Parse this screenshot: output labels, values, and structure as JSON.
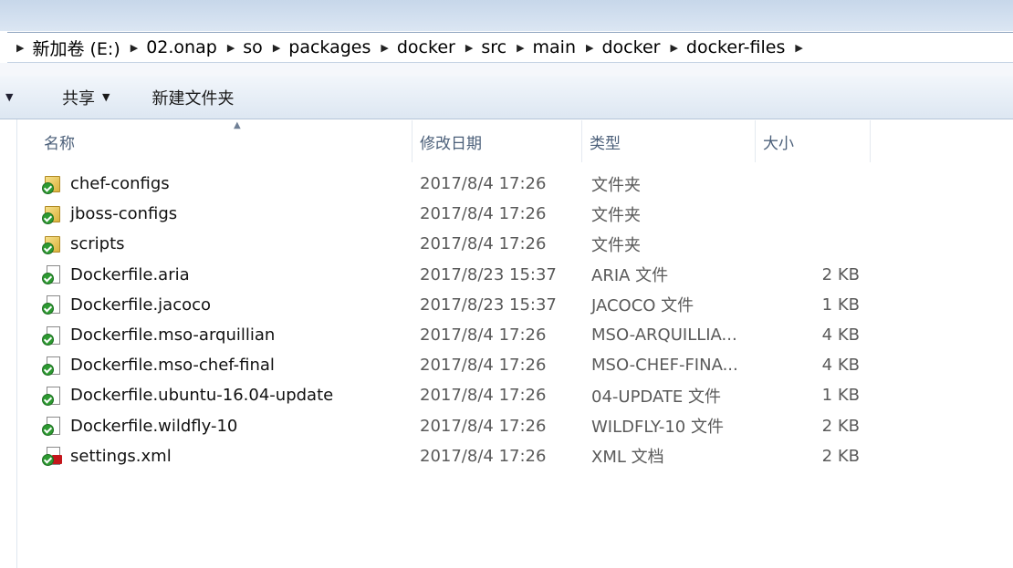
{
  "breadcrumb": [
    "新加卷 (E:)",
    "02.onap",
    "so",
    "packages",
    "docker",
    "src",
    "main",
    "docker",
    "docker-files"
  ],
  "toolbar": {
    "share_label": "共享",
    "new_folder_label": "新建文件夹"
  },
  "columns": {
    "name": "名称",
    "date": "修改日期",
    "type": "类型",
    "size": "大小"
  },
  "files": [
    {
      "name": "chef-configs",
      "date": "2017/8/4 17:26",
      "type": "文件夹",
      "size": "",
      "icon": "folder-icon"
    },
    {
      "name": "jboss-configs",
      "date": "2017/8/4 17:26",
      "type": "文件夹",
      "size": "",
      "icon": "folder-icon"
    },
    {
      "name": "scripts",
      "date": "2017/8/4 17:26",
      "type": "文件夹",
      "size": "",
      "icon": "folder-icon"
    },
    {
      "name": "Dockerfile.aria",
      "date": "2017/8/23 15:37",
      "type": "ARIA 文件",
      "size": "2 KB",
      "icon": "file-icon"
    },
    {
      "name": "Dockerfile.jacoco",
      "date": "2017/8/23 15:37",
      "type": "JACOCO 文件",
      "size": "1 KB",
      "icon": "file-icon"
    },
    {
      "name": "Dockerfile.mso-arquillian",
      "date": "2017/8/4 17:26",
      "type": "MSO-ARQUILLIA...",
      "size": "4 KB",
      "icon": "file-icon"
    },
    {
      "name": "Dockerfile.mso-chef-final",
      "date": "2017/8/4 17:26",
      "type": "MSO-CHEF-FINA...",
      "size": "4 KB",
      "icon": "file-icon"
    },
    {
      "name": "Dockerfile.ubuntu-16.04-update",
      "date": "2017/8/4 17:26",
      "type": "04-UPDATE 文件",
      "size": "1 KB",
      "icon": "file-icon"
    },
    {
      "name": "Dockerfile.wildfly-10",
      "date": "2017/8/4 17:26",
      "type": "WILDFLY-10 文件",
      "size": "2 KB",
      "icon": "file-icon"
    },
    {
      "name": "settings.xml",
      "date": "2017/8/4 17:26",
      "type": "XML 文档",
      "size": "2 KB",
      "icon": "xml-file-icon"
    }
  ]
}
